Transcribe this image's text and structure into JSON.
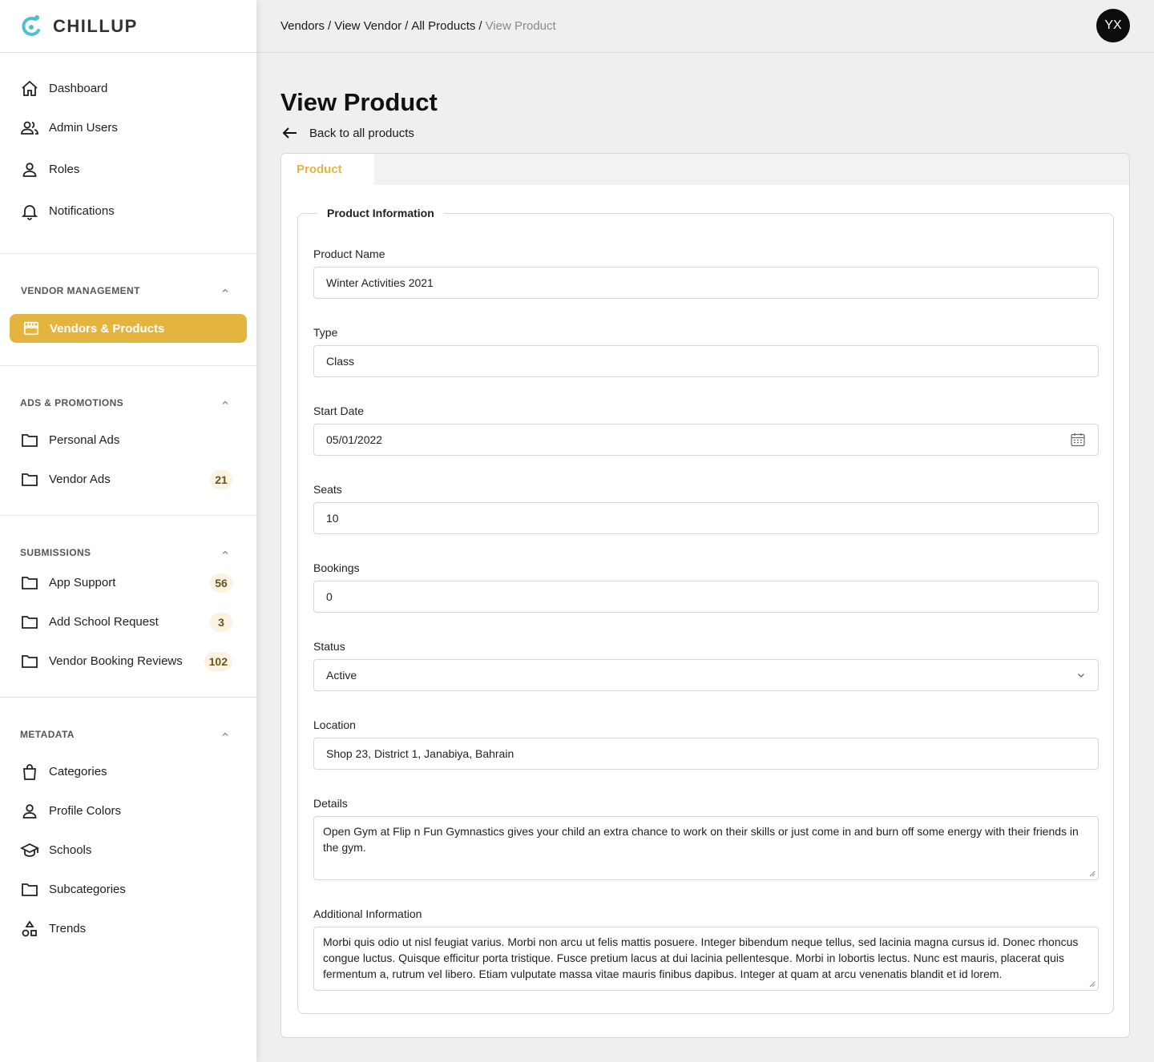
{
  "brand": {
    "name": "CHILLUP"
  },
  "sidebar": {
    "main_items": [
      {
        "label": "Dashboard",
        "icon": "home-icon"
      },
      {
        "label": "Admin Users",
        "icon": "users-icon"
      },
      {
        "label": "Roles",
        "icon": "person-icon"
      },
      {
        "label": "Notifications",
        "icon": "bell-icon"
      }
    ],
    "sections": [
      {
        "title": "VENDOR MANAGEMENT",
        "items": [
          {
            "label": "Vendors & Products",
            "icon": "store-icon",
            "active": true
          }
        ]
      },
      {
        "title": "ADS & PROMOTIONS",
        "items": [
          {
            "label": "Personal Ads",
            "icon": "folder-icon",
            "badge": ""
          },
          {
            "label": "Vendor Ads",
            "icon": "folder-icon",
            "badge": "21"
          }
        ]
      },
      {
        "title": "SUBMISSIONS",
        "items": [
          {
            "label": "App Support",
            "icon": "folder-icon",
            "badge": "56"
          },
          {
            "label": "Add School Request",
            "icon": "folder-icon",
            "badge": "3"
          },
          {
            "label": "Vendor Booking Reviews",
            "icon": "folder-icon",
            "badge": "102"
          }
        ]
      },
      {
        "title": "METADATA",
        "items": [
          {
            "label": "Categories",
            "icon": "shopping-bag-icon"
          },
          {
            "label": "Profile Colors",
            "icon": "person-icon"
          },
          {
            "label": "Schools",
            "icon": "school-icon"
          },
          {
            "label": "Subcategories",
            "icon": "folder-icon"
          },
          {
            "label": "Trends",
            "icon": "shapes-icon"
          }
        ]
      }
    ]
  },
  "header": {
    "breadcrumb": [
      "Vendors",
      "View Vendor",
      "All Products",
      "View Product"
    ],
    "avatar_initials": "YX"
  },
  "page": {
    "title": "View Product",
    "back_label": "Back to all products",
    "tab": "Product",
    "legend": "Product Information",
    "fields": {
      "product_name": {
        "label": "Product Name",
        "value": "Winter Activities 2021"
      },
      "type": {
        "label": "Type",
        "value": "Class"
      },
      "start_date": {
        "label": "Start Date",
        "value": "05/01/2022"
      },
      "seats": {
        "label": "Seats",
        "value": "10"
      },
      "bookings": {
        "label": "Bookings",
        "value": "0"
      },
      "status": {
        "label": "Status",
        "value": "Active"
      },
      "location": {
        "label": "Location",
        "value": "Shop 23, District 1, Janabiya, Bahrain"
      },
      "details": {
        "label": "Details",
        "value": "Open Gym at Flip n Fun Gymnastics gives your child an extra chance to work on their skills or just come in and burn off some energy with their friends in the gym."
      },
      "additional_info": {
        "label": "Additional Information",
        "value": "Morbi quis odio ut nisl feugiat varius. Morbi non arcu ut felis mattis posuere. Integer bibendum neque tellus, sed lacinia magna cursus id. Donec rhoncus congue luctus. Quisque efficitur porta tristique. Fusce pretium lacus at dui lacinia pellentesque. Morbi in lobortis lectus. Nunc est mauris, placerat quis fermentum a, rutrum vel libero. Etiam vulputate massa vitae mauris finibus dapibus. Integer at quam at arcu venenatis blandit et id lorem."
      }
    }
  },
  "colors": {
    "accent": "#e3b53e",
    "logo": "#4cc3c7",
    "badge_bg": "#fbf3e0"
  }
}
